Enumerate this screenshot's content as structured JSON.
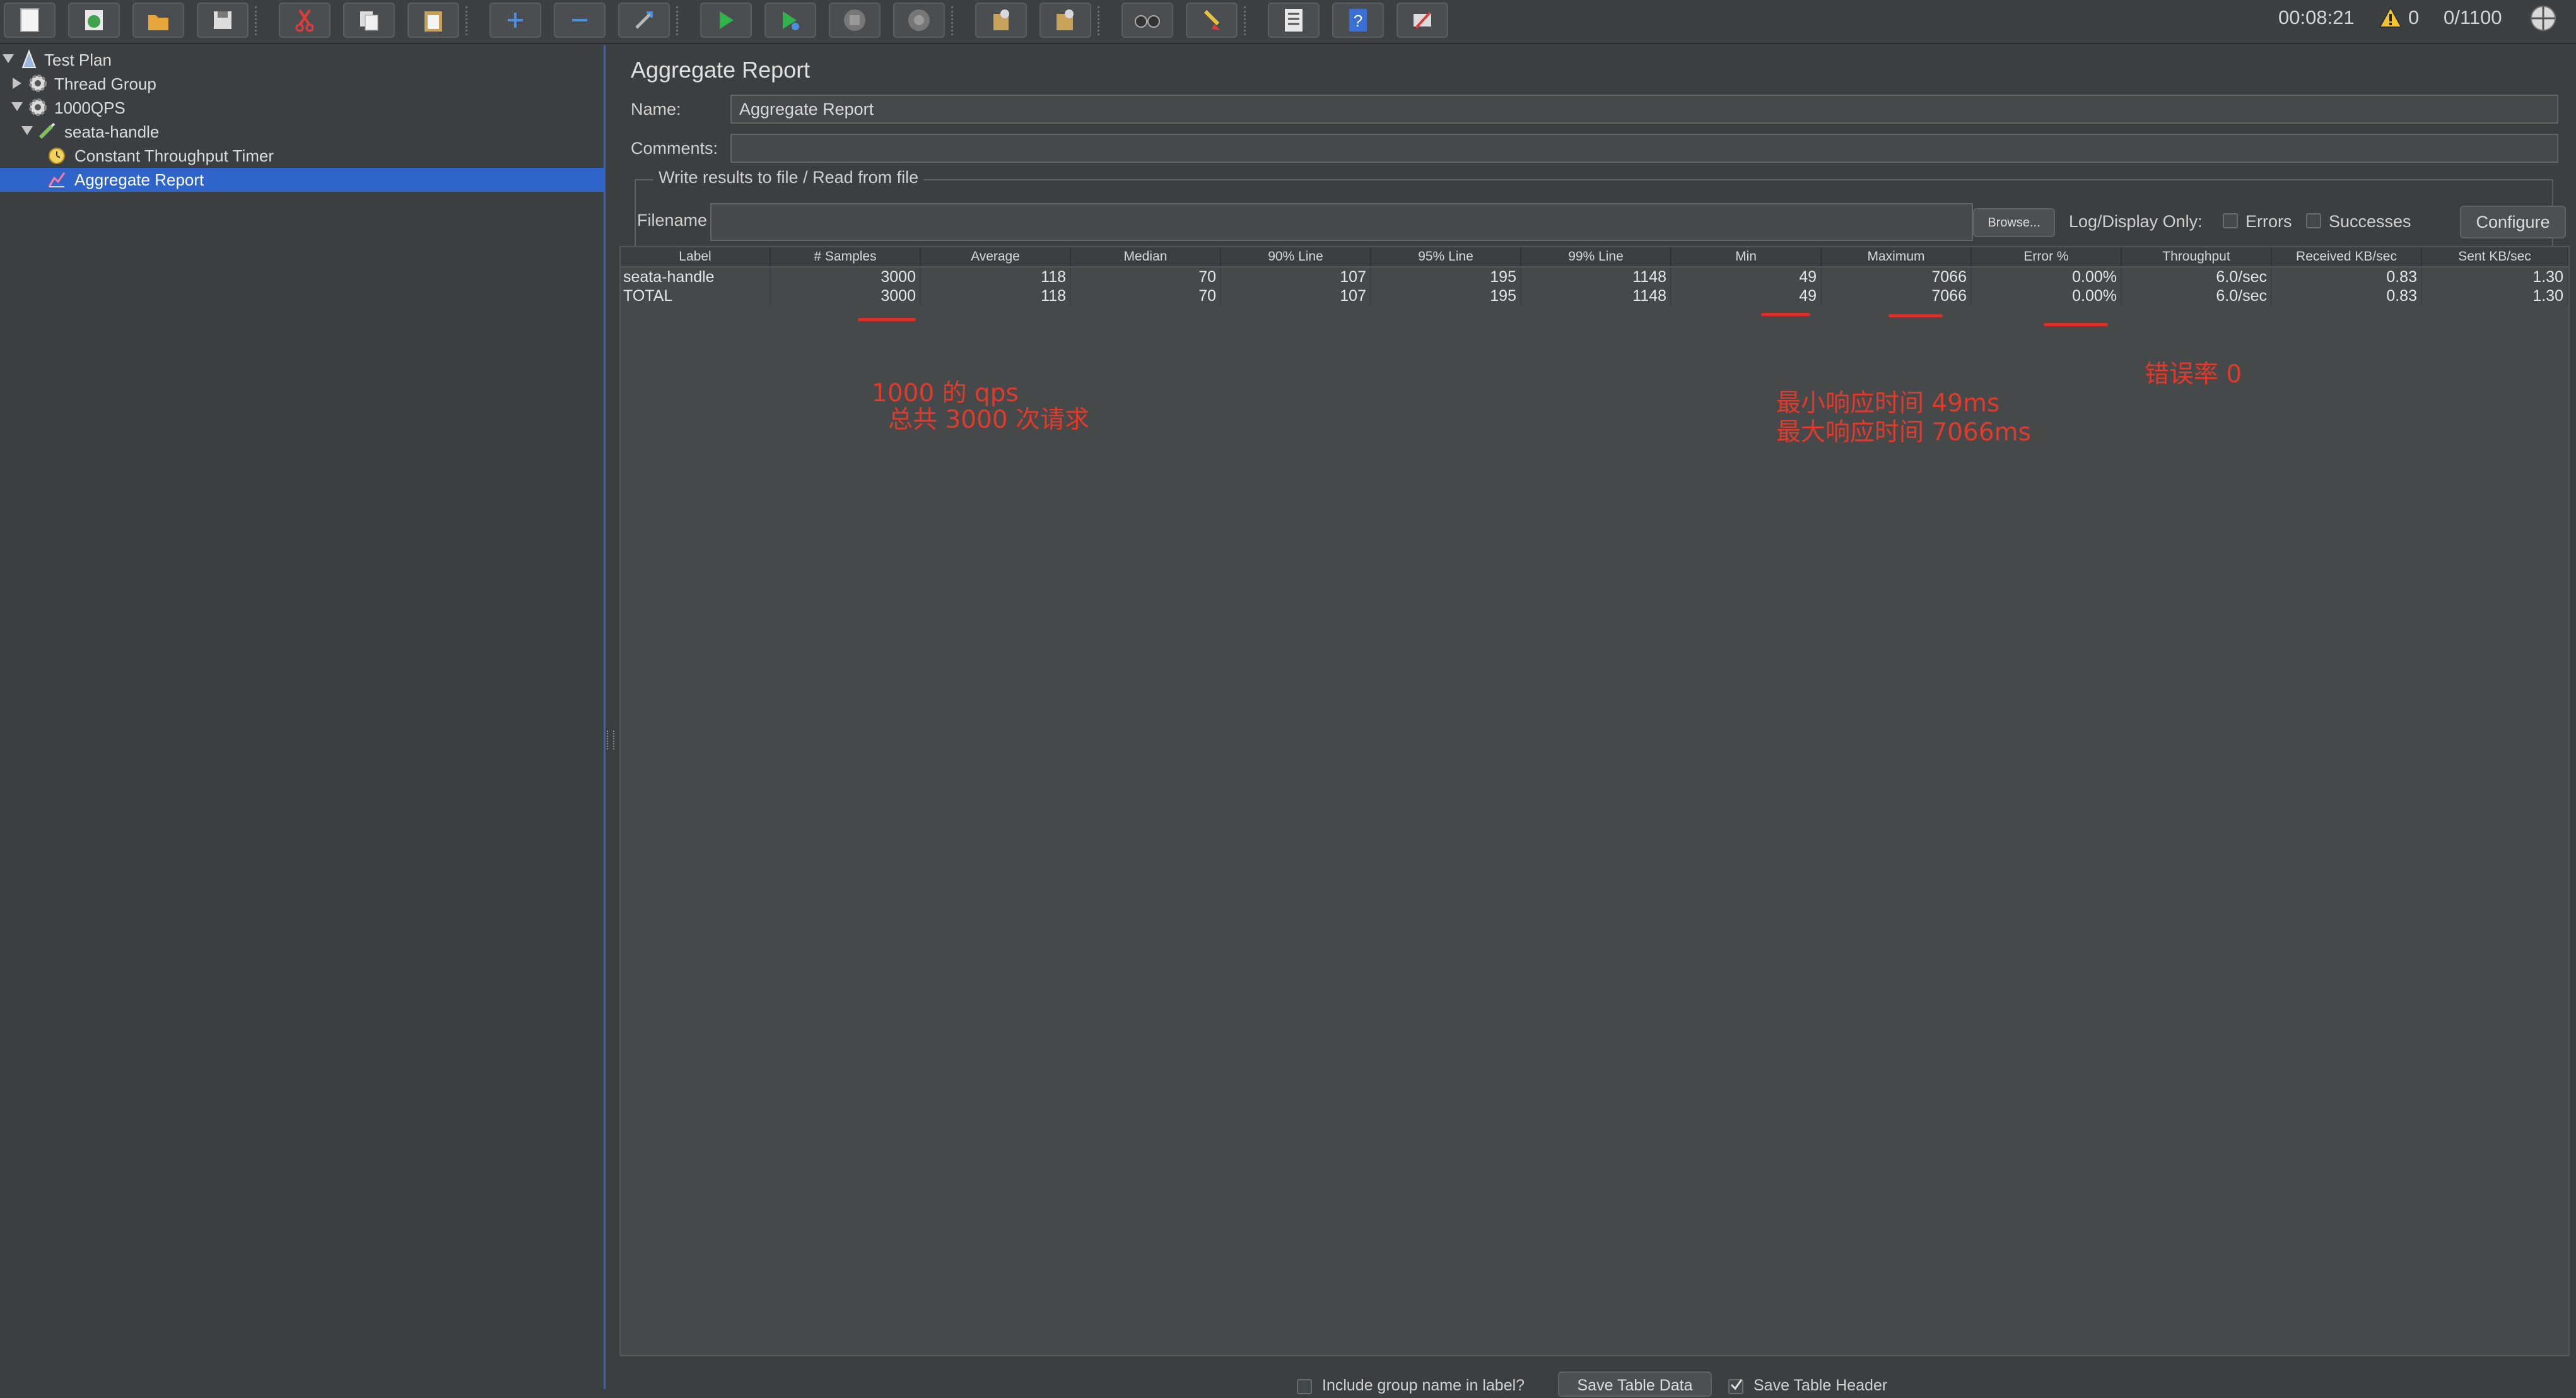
{
  "toolbar": {
    "buttons": [
      "new-icon",
      "templates-icon",
      "open-icon",
      "save-icon",
      "cut-icon",
      "copy-icon",
      "paste-icon",
      "expand-icon",
      "collapse-icon",
      "toggle-icon",
      "start-icon",
      "start-no-pause-icon",
      "stop-icon",
      "shutdown-icon",
      "clear-icon",
      "clear-all-icon",
      "search-icon",
      "reset-search-icon",
      "function-helper-icon",
      "help-icon",
      "remote-icon"
    ],
    "elapsed_time": "00:08:21",
    "warning_count": "0",
    "active_threads": "0/1100"
  },
  "tree": {
    "items": [
      {
        "label": "Test Plan",
        "icon": "test-plan-icon",
        "expanded": true
      },
      {
        "label": "Thread Group",
        "icon": "thread-group-icon",
        "expanded": false
      },
      {
        "label": "1000QPS",
        "icon": "thread-group-icon",
        "expanded": true
      },
      {
        "label": "seata-handle",
        "icon": "http-sampler-icon",
        "expanded": true
      },
      {
        "label": "Constant Throughput Timer",
        "icon": "timer-icon"
      },
      {
        "label": "Aggregate Report",
        "icon": "report-icon",
        "selected": true
      }
    ]
  },
  "panel": {
    "title": "Aggregate Report",
    "name_label": "Name:",
    "name_value": "Aggregate Report",
    "comments_label": "Comments:",
    "comments_value": "",
    "file_group_title": "Write results to file / Read from file",
    "filename_label": "Filename",
    "filename_value": "",
    "browse_label": "Browse...",
    "log_display_label": "Log/Display Only:",
    "errors_label": "Errors",
    "successes_label": "Successes",
    "configure_label": "Configure"
  },
  "table": {
    "headers": [
      "Label",
      "# Samples",
      "Average",
      "Median",
      "90% Line",
      "95% Line",
      "99% Line",
      "Min",
      "Maximum",
      "Error %",
      "Throughput",
      "Received KB/sec",
      "Sent KB/sec"
    ],
    "rows": [
      [
        "seata-handle",
        "3000",
        "118",
        "70",
        "107",
        "195",
        "1148",
        "49",
        "7066",
        "0.00%",
        "6.0/sec",
        "0.83",
        "1.30"
      ],
      [
        "TOTAL",
        "3000",
        "118",
        "70",
        "107",
        "195",
        "1148",
        "49",
        "7066",
        "0.00%",
        "6.0/sec",
        "0.83",
        "1.30"
      ]
    ]
  },
  "annotations": {
    "qps_line1": "1000 的 qps",
    "qps_line2": "总共 3000 次请求",
    "time_line1": "最小响应时间 49ms",
    "time_line2": "最大响应时间 7066ms",
    "error_rate": "错误率 0",
    "color": "#e23a2a"
  },
  "bottom": {
    "include_group_label": "Include group name in label?",
    "save_table_data_label": "Save Table Data",
    "save_table_header_label": "Save Table Header"
  },
  "colors": {
    "background": "#3c3f41",
    "selection": "#2f65ca",
    "field": "#45494a"
  }
}
